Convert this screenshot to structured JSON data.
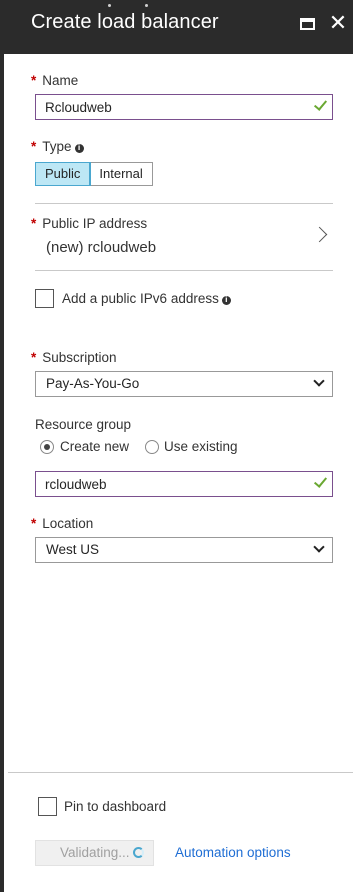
{
  "blade": {
    "title": "Create load balancer"
  },
  "form": {
    "name": {
      "label": "Name",
      "value": "Rcloudweb"
    },
    "type": {
      "label": "Type",
      "options": [
        "Public",
        "Internal"
      ],
      "selected": "Public"
    },
    "public_ip": {
      "label": "Public IP address",
      "value": "(new) rcloudweb"
    },
    "ipv6": {
      "label": "Add a public IPv6 address",
      "checked": false
    },
    "subscription": {
      "label": "Subscription",
      "value": "Pay-As-You-Go"
    },
    "resource_group": {
      "label": "Resource group",
      "options": [
        "Create new",
        "Use existing"
      ],
      "selected": "Create new",
      "value": "rcloudweb"
    },
    "location": {
      "label": "Location",
      "value": "West US"
    }
  },
  "footer": {
    "pin_label": "Pin to dashboard",
    "pin_checked": false,
    "validate_label": "Validating...",
    "automation_label": "Automation options"
  },
  "colors": {
    "header_bg": "#2b2b2b",
    "required": "#c00000",
    "selected_segment": "#bde7f5",
    "input_border": "#7a4f8e",
    "valid_check": "#6aa832",
    "link": "#1f6ed4"
  },
  "icons": [
    "maximize-icon",
    "close-icon",
    "info-icon",
    "chevron-right-icon",
    "chevron-down-icon",
    "checkmark-icon",
    "spinner-icon"
  ]
}
